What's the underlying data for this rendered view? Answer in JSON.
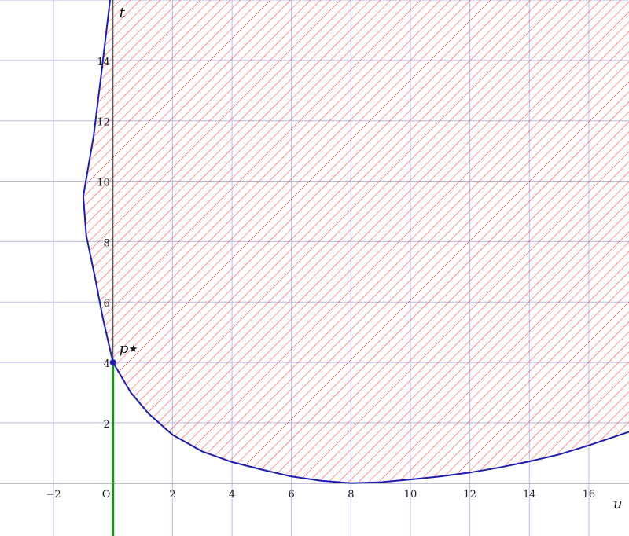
{
  "chart_data": {
    "type": "line",
    "title": "",
    "xlabel": "u",
    "ylabel": "t",
    "xlim": [
      -3.8,
      17.35
    ],
    "ylim": [
      -1.75,
      16
    ],
    "grid": true,
    "x_ticks": [
      -2,
      2,
      4,
      6,
      8,
      10,
      12,
      14,
      16
    ],
    "y_ticks": [
      2,
      4,
      6,
      8,
      10,
      12,
      14
    ],
    "origin_label": "O",
    "colors": {
      "grid": "#b8b8e8",
      "curve": "#1c1cb4",
      "hatch": "#ff2a2a",
      "segment": "#119911",
      "point": "#1c1cb4",
      "axis": "#333333"
    },
    "series": [
      {
        "kind": "boundary-curve",
        "points": [
          [
            -0.1,
            16.0
          ],
          [
            -0.4,
            13.5
          ],
          [
            -0.65,
            11.5
          ],
          [
            -1.0,
            9.5
          ],
          [
            -0.9,
            8.2
          ],
          [
            -0.6,
            6.8
          ],
          [
            -0.35,
            5.5
          ],
          [
            0,
            4.0
          ],
          [
            0.6,
            3.0
          ],
          [
            1.2,
            2.3
          ],
          [
            2,
            1.6
          ],
          [
            3,
            1.05
          ],
          [
            4,
            0.7
          ],
          [
            5,
            0.45
          ],
          [
            6,
            0.22
          ],
          [
            7,
            0.08
          ],
          [
            8,
            0.0
          ],
          [
            9,
            0.03
          ],
          [
            10,
            0.12
          ],
          [
            11,
            0.22
          ],
          [
            12,
            0.35
          ],
          [
            13,
            0.52
          ],
          [
            14,
            0.72
          ],
          [
            15,
            0.95
          ],
          [
            16,
            1.25
          ],
          [
            17.35,
            1.7
          ]
        ]
      },
      {
        "kind": "segment",
        "points": [
          [
            0,
            -1.75
          ],
          [
            0,
            4.0
          ]
        ]
      }
    ],
    "region": "hatched area above boundary curve",
    "point": {
      "label": "p",
      "marker": "★",
      "u": 0,
      "t": 4.0
    }
  }
}
